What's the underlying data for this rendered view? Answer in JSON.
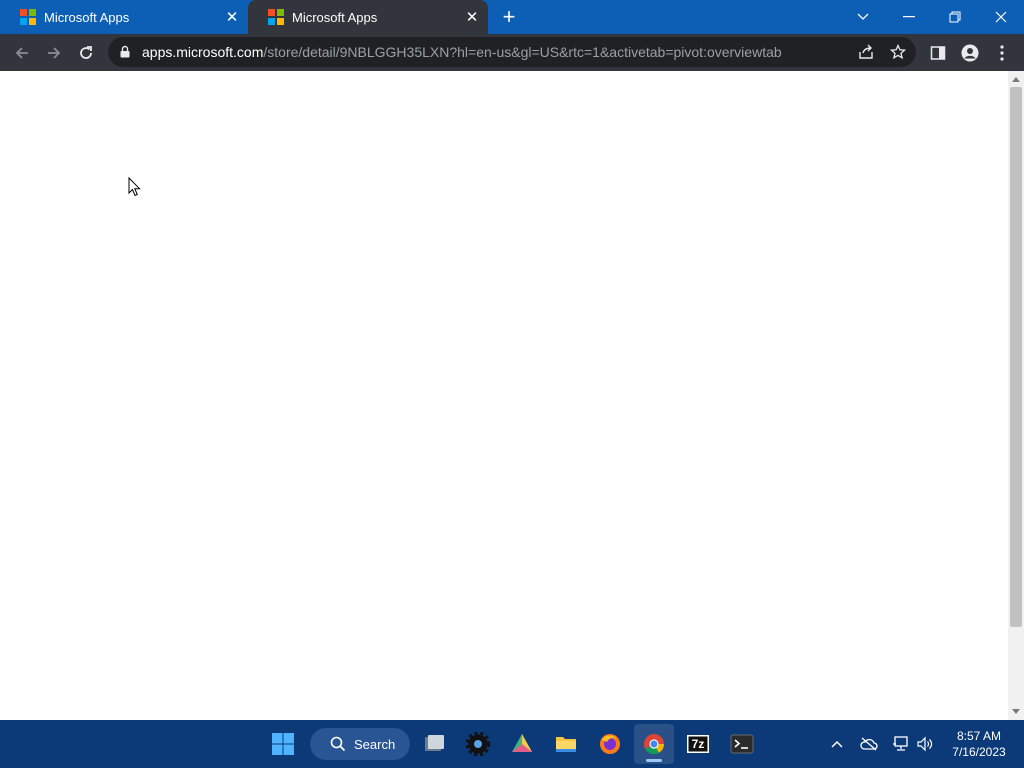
{
  "browser": {
    "tabs": [
      {
        "title": "Microsoft Apps",
        "active": false
      },
      {
        "title": "Microsoft Apps",
        "active": true
      }
    ],
    "new_tab_icon": "plus-icon",
    "window_controls": [
      "chevron-down-icon",
      "minimize-icon",
      "restore-icon",
      "close-icon"
    ],
    "url": {
      "host": "apps.microsoft.com",
      "path": "/store/detail/9NBLGGH35LXN?hl=en-us&gl=US&rtc=1&activetab=pivot:overviewtab"
    }
  },
  "taskbar": {
    "search_label": "Search",
    "apps": [
      "windows-start-icon",
      "search-icon",
      "task-view-icon",
      "settings-icon",
      "photos-icon",
      "file-explorer-icon",
      "firefox-icon",
      "chrome-icon",
      "7zip-icon",
      "terminal-icon"
    ],
    "app_7zip_text": "7z",
    "tray": [
      "chevron-up-icon",
      "onedrive-icon",
      "network-icon",
      "volume-icon"
    ],
    "time": "8:57 AM",
    "date": "7/16/2023"
  },
  "colors": {
    "tabstrip": "#0c5fb4",
    "toolbar": "#32363c",
    "omnibox": "#1f2124",
    "taskbar": "#0c3a78",
    "content": "#ffffff"
  }
}
